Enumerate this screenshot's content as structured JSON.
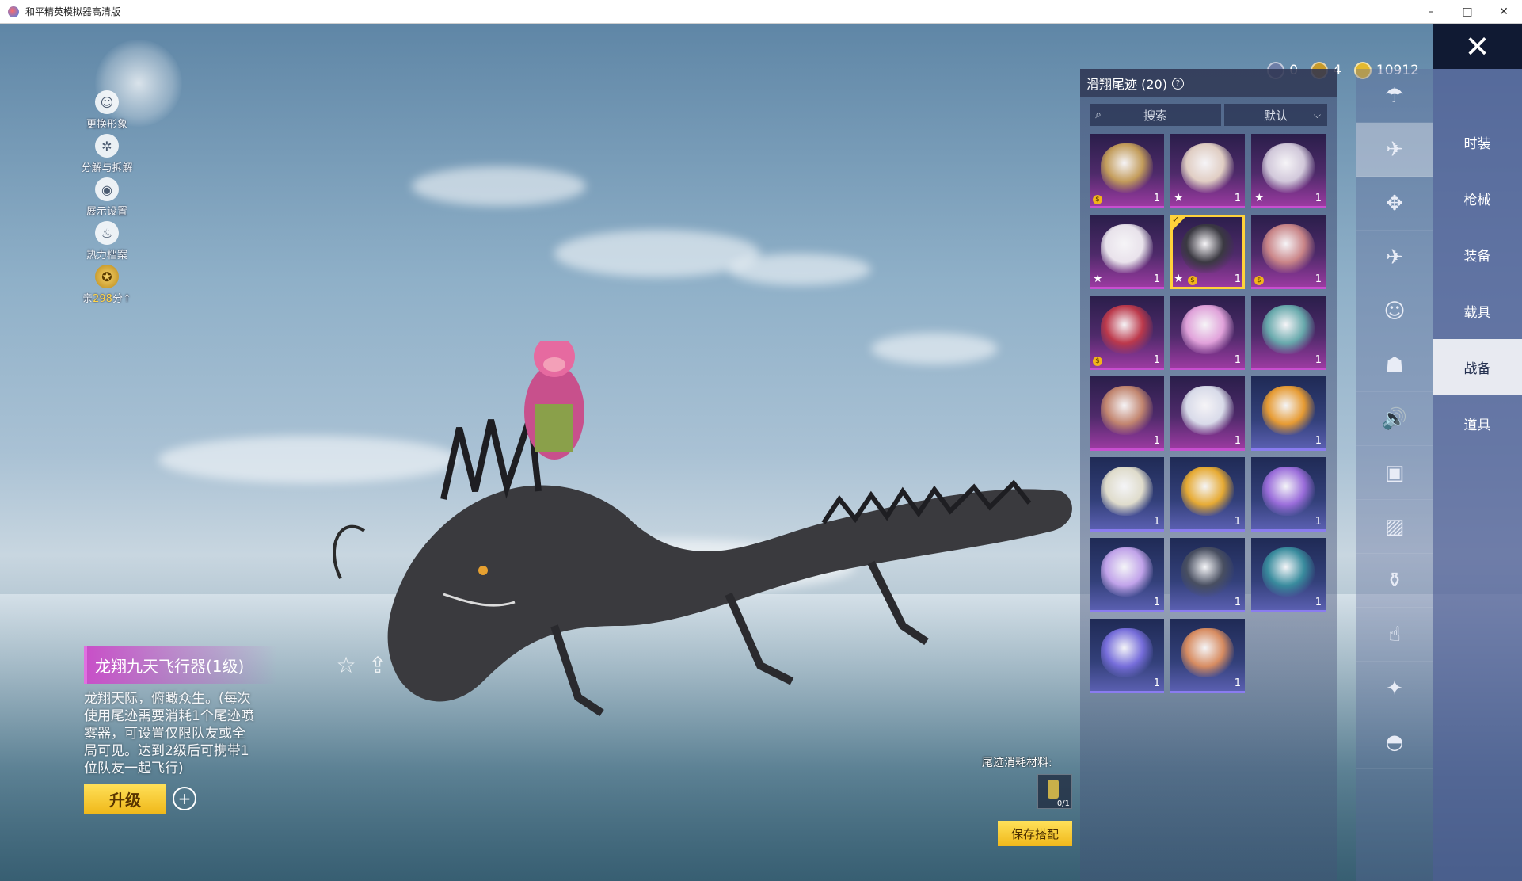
{
  "window": {
    "title": "和平精英模拟器高清版",
    "controls": [
      "–",
      "□",
      "✕"
    ]
  },
  "left_menu": [
    {
      "label": "更换形象",
      "icon": "person-icon"
    },
    {
      "label": "分解与拆解",
      "icon": "gear-icon"
    },
    {
      "label": "展示设置",
      "icon": "eye-icon"
    },
    {
      "label": "热力档案",
      "icon": "flame-icon"
    },
    {
      "label_prefix": "亲",
      "label_value": "298",
      "label_suffix": "分↑",
      "icon": "badge-icon"
    }
  ],
  "item": {
    "name": "龙翔九天飞行器(1级)",
    "description": "龙翔天际，俯瞰众生。(每次使用尾迹需要消耗1个尾迹喷雾器，可设置仅限队友或全局可见。达到2级后可携带1位队友一起飞行)",
    "upgrade_label": "升级",
    "plus_label": "+"
  },
  "currency": [
    {
      "icon": "moon-coin-icon",
      "value": "0",
      "color": "#6f7fa8"
    },
    {
      "icon": "gold-token-icon",
      "value": "4",
      "color": "#c79a2a"
    },
    {
      "icon": "coupon-icon",
      "value": "10912",
      "color": "#e3b92f"
    }
  ],
  "panel": {
    "title": "滑翔尾迹 (20)",
    "help": "?",
    "search_placeholder": "搜索",
    "sort_label": "默认",
    "items": [
      {
        "name": "golden-dragon-wings",
        "rarity": "purple",
        "badge": "coin",
        "qty": "1",
        "color": "#c9a25a"
      },
      {
        "name": "white-phoenix-wings",
        "rarity": "purple",
        "badge": "star",
        "qty": "1",
        "color": "#e8d6c8"
      },
      {
        "name": "skeleton-dragon",
        "rarity": "purple",
        "badge": "star",
        "qty": "1",
        "color": "#d8d0e0"
      },
      {
        "name": "white-cat-plush",
        "rarity": "purple",
        "badge": "star",
        "qty": "1",
        "color": "#f1ecf2"
      },
      {
        "name": "black-ink-dragon",
        "rarity": "purple",
        "badge": "star-coin",
        "qty": "1",
        "selected": true,
        "color": "#3a3a40"
      },
      {
        "name": "pink-pig",
        "rarity": "purple",
        "badge": "coin",
        "qty": "1",
        "color": "#d08a8a"
      },
      {
        "name": "red-crystal-wings",
        "rarity": "purple",
        "badge": "coin",
        "qty": "1",
        "color": "#c23a4a"
      },
      {
        "name": "pink-lotus-crystal",
        "rarity": "purple",
        "badge": "",
        "qty": "1",
        "color": "#e8a8e0"
      },
      {
        "name": "teal-mech-wings",
        "rarity": "purple",
        "badge": "",
        "qty": "1",
        "color": "#6ab0b0"
      },
      {
        "name": "rose-gold-blades",
        "rarity": "purple",
        "badge": "",
        "qty": "1",
        "color": "#c88a70"
      },
      {
        "name": "silver-feather-wings",
        "rarity": "purple",
        "badge": "",
        "qty": "1",
        "color": "#e0e4f0"
      },
      {
        "name": "lucky-horse",
        "rarity": "blue",
        "badge": "",
        "qty": "1",
        "color": "#f0a030"
      },
      {
        "name": "jet-glider",
        "rarity": "blue",
        "badge": "",
        "qty": "1",
        "color": "#e8e4d0"
      },
      {
        "name": "golden-chick",
        "rarity": "blue",
        "badge": "",
        "qty": "1",
        "color": "#f0b030"
      },
      {
        "name": "rainbow-smoke-trail",
        "rarity": "blue",
        "badge": "",
        "qty": "1",
        "color": "#a070e0"
      },
      {
        "name": "holo-ufo",
        "rarity": "blue",
        "badge": "",
        "qty": "1",
        "color": "#c8a8f0"
      },
      {
        "name": "black-jet",
        "rarity": "blue",
        "badge": "",
        "qty": "1",
        "color": "#4a5060"
      },
      {
        "name": "teal-dragon-wing",
        "rarity": "blue",
        "badge": "",
        "qty": "1",
        "color": "#3a90a0"
      },
      {
        "name": "purple-smoke-trail",
        "rarity": "blue",
        "badge": "",
        "qty": "1",
        "color": "#7a70e0"
      },
      {
        "name": "flame-smoke-trail",
        "rarity": "blue",
        "badge": "",
        "qty": "1",
        "color": "#e09060"
      }
    ]
  },
  "category_icons": [
    {
      "name": "parachute-icon",
      "glyph": "☂",
      "active": false
    },
    {
      "name": "glider-trail-icon",
      "glyph": "✈",
      "active": true
    },
    {
      "name": "drone-icon",
      "glyph": "✥",
      "active": false
    },
    {
      "name": "plane-icon",
      "glyph": "✈",
      "active": false
    },
    {
      "name": "emote-face-icon",
      "glyph": "☺",
      "active": false
    },
    {
      "name": "robot-icon",
      "glyph": "☗",
      "active": false
    },
    {
      "name": "sound-icon",
      "glyph": "🔊",
      "active": false
    },
    {
      "name": "card-icon",
      "glyph": "▣",
      "active": false
    },
    {
      "name": "photo-icon",
      "glyph": "▨",
      "active": false
    },
    {
      "name": "spray-icon",
      "glyph": "⚱",
      "active": false
    },
    {
      "name": "hand-icon",
      "glyph": "☝",
      "active": false
    },
    {
      "name": "wand-icon",
      "glyph": "✦",
      "active": false
    },
    {
      "name": "bowl-icon",
      "glyph": "◓",
      "active": false
    }
  ],
  "tabs": [
    {
      "label": "时装",
      "active": false
    },
    {
      "label": "枪械",
      "active": false
    },
    {
      "label": "装备",
      "active": false
    },
    {
      "label": "载具",
      "active": false
    },
    {
      "label": "战备",
      "active": true
    },
    {
      "label": "道具",
      "active": false
    }
  ],
  "close_label": "✕",
  "consume": {
    "label": "尾迹消耗材料:",
    "count": "0/1"
  },
  "save_label": "保存搭配",
  "share": {
    "fav_glyph": "☆",
    "share_glyph": "⇪"
  }
}
